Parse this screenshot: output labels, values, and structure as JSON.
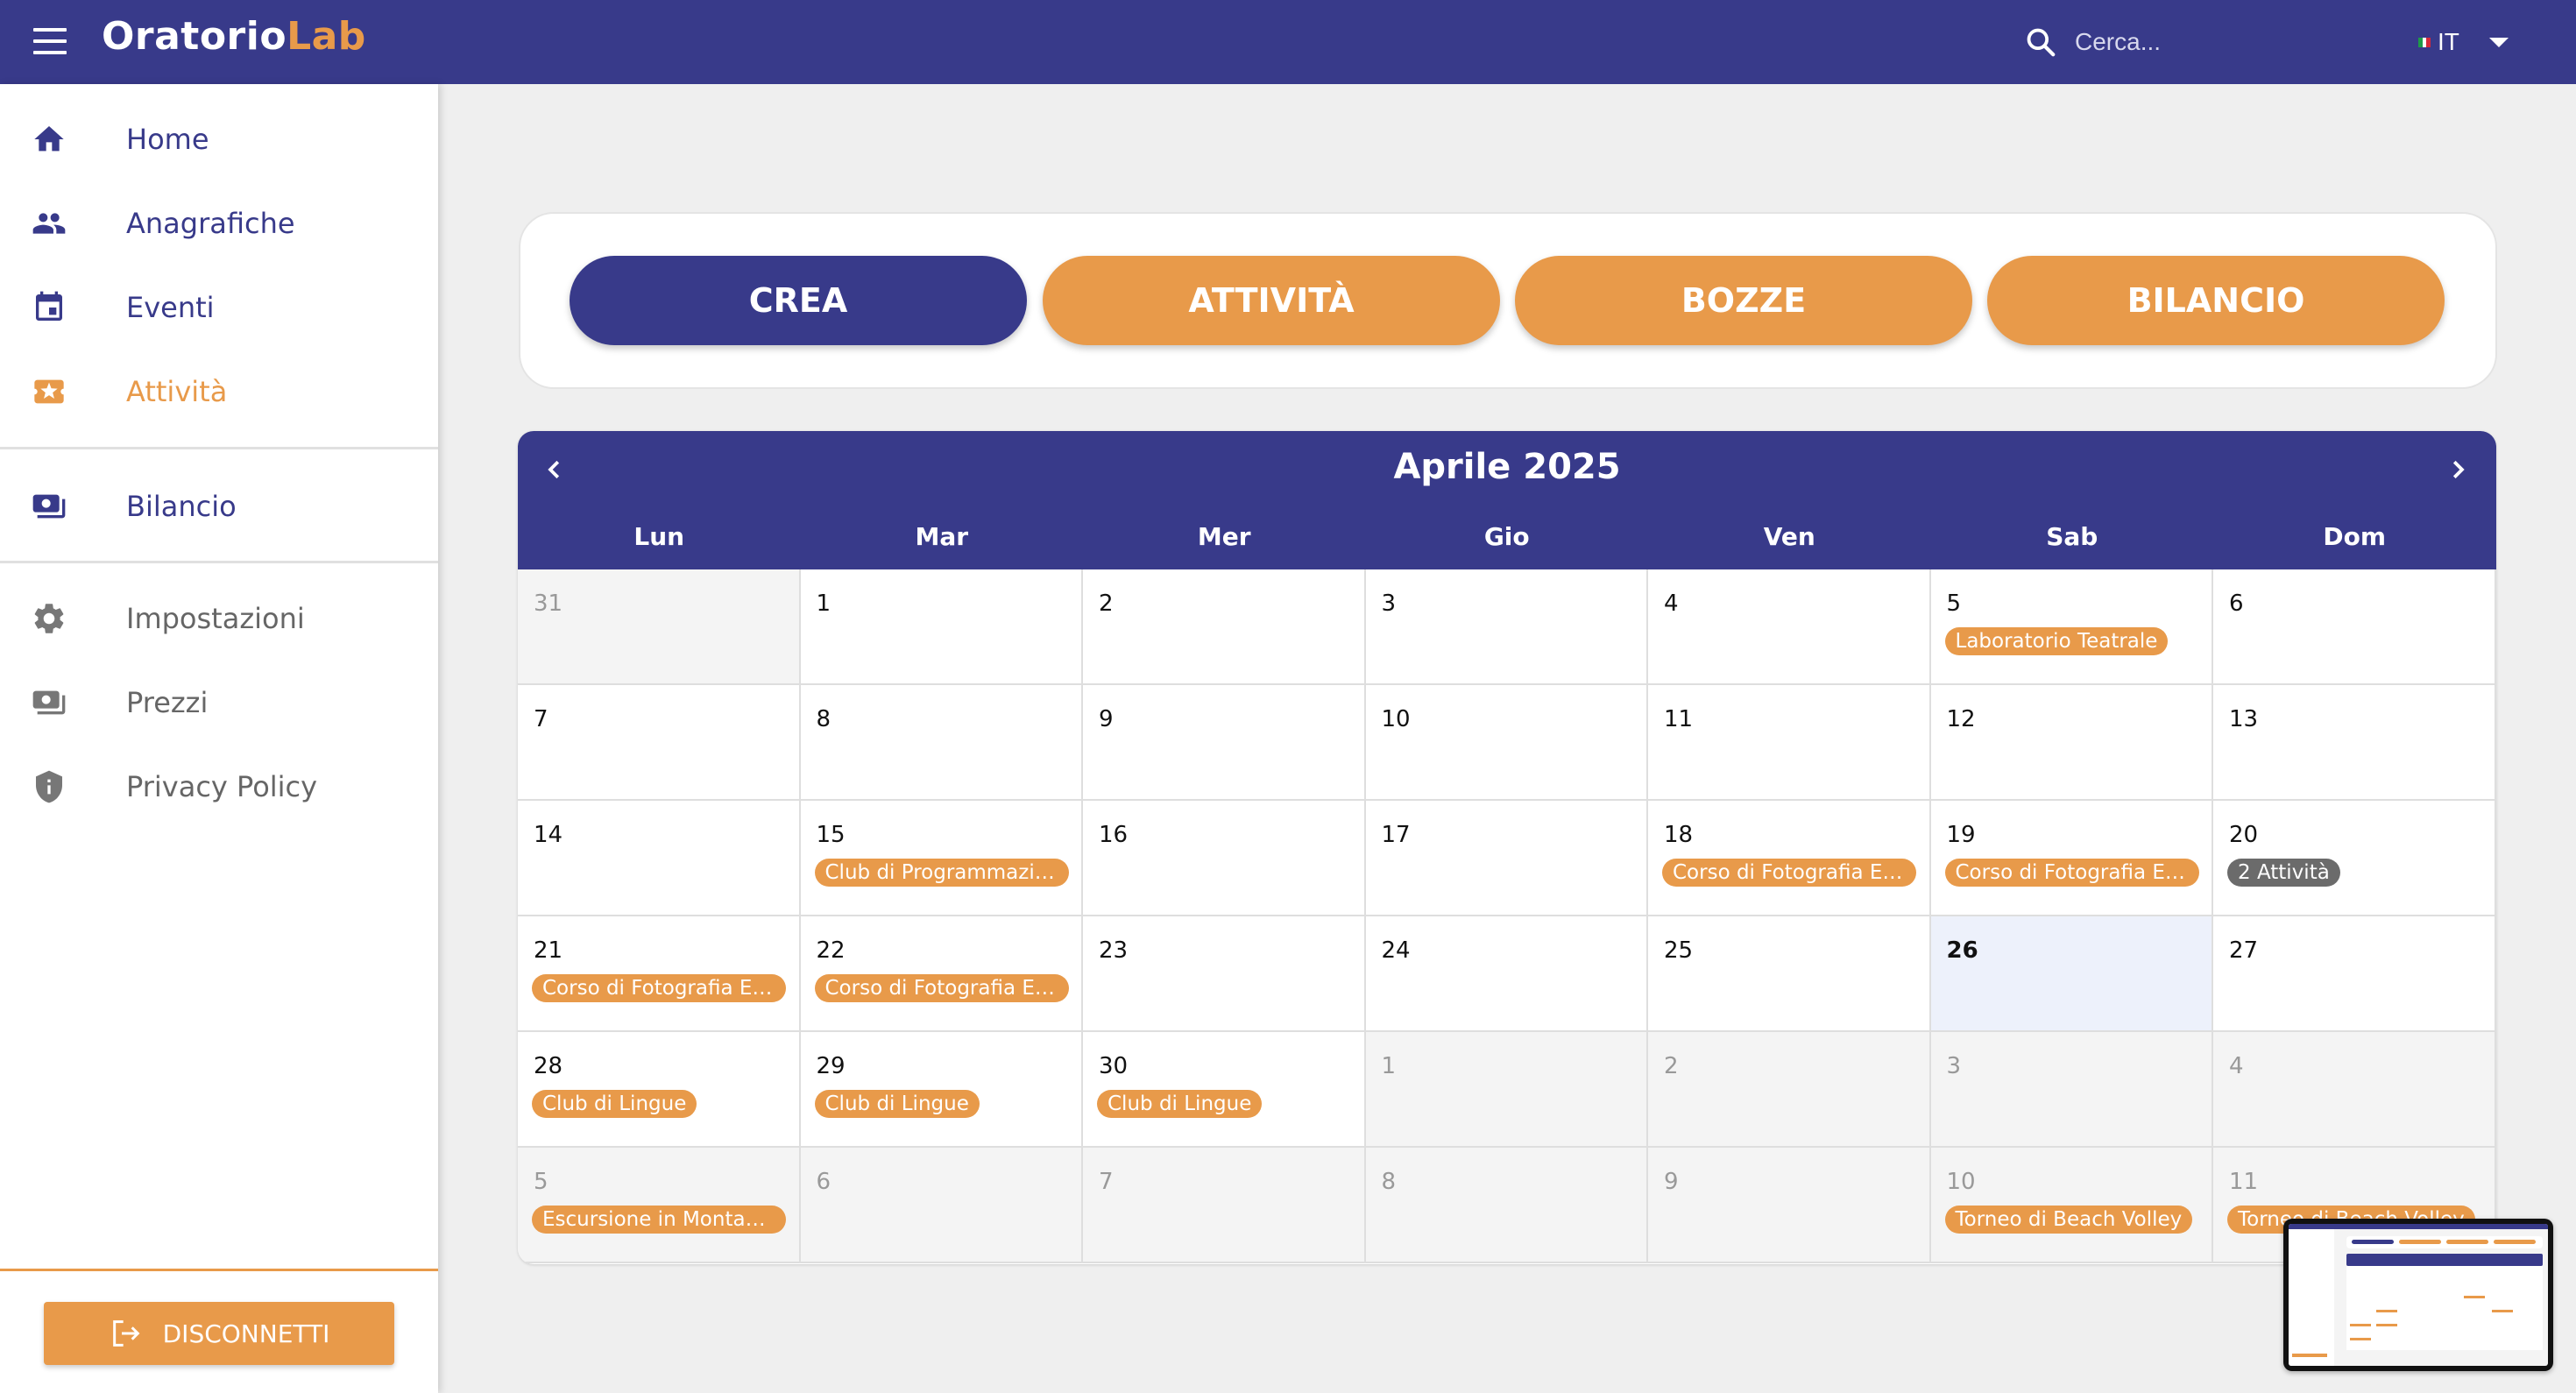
{
  "app": {
    "brand_part1": "Oratorio",
    "brand_part2": "Lab"
  },
  "search": {
    "placeholder": "Cerca..."
  },
  "language": {
    "code": "IT"
  },
  "sidebar": {
    "items": [
      {
        "label": "Home",
        "icon": "home-icon"
      },
      {
        "label": "Anagrafiche",
        "icon": "people-icon"
      },
      {
        "label": "Eventi",
        "icon": "calendar-icon"
      },
      {
        "label": "Attività",
        "icon": "ticket-star-icon",
        "active": true
      },
      {
        "label": "Bilancio",
        "icon": "money-icon"
      },
      {
        "label": "Impostazioni",
        "icon": "gear-icon"
      },
      {
        "label": "Prezzi",
        "icon": "money-icon"
      },
      {
        "label": "Privacy Policy",
        "icon": "shield-icon"
      }
    ],
    "logout_label": "DISCONNETTI"
  },
  "actions": {
    "create": "CREA",
    "activities": "ATTIVITÀ",
    "drafts": "BOZZE",
    "balance": "BILANCIO"
  },
  "calendar": {
    "title": "Aprile 2025",
    "weekdays": [
      "Lun",
      "Mar",
      "Mer",
      "Gio",
      "Ven",
      "Sab",
      "Dom"
    ],
    "weeks": [
      [
        {
          "d": "31",
          "other": true
        },
        {
          "d": "1"
        },
        {
          "d": "2"
        },
        {
          "d": "3"
        },
        {
          "d": "4"
        },
        {
          "d": "5",
          "ev": "Laboratorio Teatrale"
        },
        {
          "d": "6"
        }
      ],
      [
        {
          "d": "7"
        },
        {
          "d": "8"
        },
        {
          "d": "9"
        },
        {
          "d": "10"
        },
        {
          "d": "11"
        },
        {
          "d": "12"
        },
        {
          "d": "13"
        }
      ],
      [
        {
          "d": "14"
        },
        {
          "d": "15",
          "ev": "Club di Programmazione"
        },
        {
          "d": "16"
        },
        {
          "d": "17"
        },
        {
          "d": "18",
          "ev": "Corso di Fotografia Estiva"
        },
        {
          "d": "19",
          "ev": "Corso di Fotografia Estiva"
        },
        {
          "d": "20",
          "ev": "2 Attività",
          "gray": true
        }
      ],
      [
        {
          "d": "21",
          "ev": "Corso di Fotografia Estiva"
        },
        {
          "d": "22",
          "ev": "Corso di Fotografia Estiva"
        },
        {
          "d": "23"
        },
        {
          "d": "24"
        },
        {
          "d": "25"
        },
        {
          "d": "26",
          "today": true
        },
        {
          "d": "27"
        }
      ],
      [
        {
          "d": "28",
          "ev": "Club di Lingue"
        },
        {
          "d": "29",
          "ev": "Club di Lingue"
        },
        {
          "d": "30",
          "ev": "Club di Lingue"
        },
        {
          "d": "1",
          "other": true
        },
        {
          "d": "2",
          "other": true
        },
        {
          "d": "3",
          "other": true
        },
        {
          "d": "4",
          "other": true
        }
      ],
      [
        {
          "d": "5",
          "other": true,
          "ev": "Escursione in Montagna"
        },
        {
          "d": "6",
          "other": true
        },
        {
          "d": "7",
          "other": true
        },
        {
          "d": "8",
          "other": true
        },
        {
          "d": "9",
          "other": true
        },
        {
          "d": "10",
          "other": true,
          "ev": "Torneo di Beach Volley"
        },
        {
          "d": "11",
          "other": true,
          "ev": "Torneo di Beach Volley"
        }
      ]
    ]
  },
  "colors": {
    "primary": "#383a8a",
    "accent": "#e89a4a",
    "today": "#edf1fb"
  }
}
